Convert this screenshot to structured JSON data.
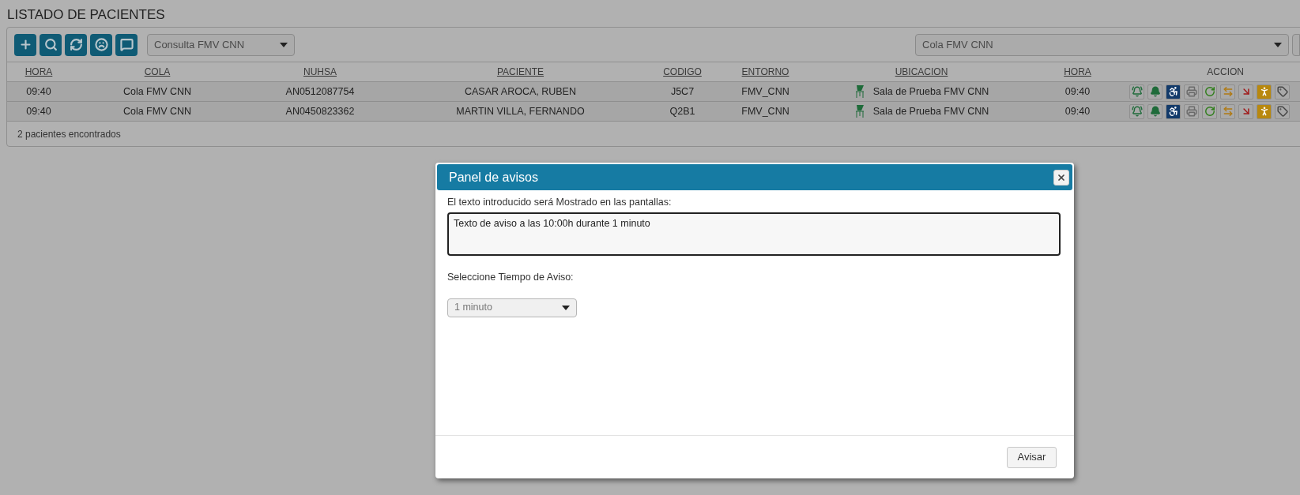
{
  "page_title": "LISTADO DE PACIENTES",
  "toolbar": {
    "consulta_select": "Consulta FMV CNN",
    "cola_select": "Cola FMV CNN"
  },
  "table": {
    "columns": [
      {
        "label": "HORA",
        "sortable": true
      },
      {
        "label": "COLA",
        "sortable": true
      },
      {
        "label": "NUHSA",
        "sortable": true
      },
      {
        "label": "PACIENTE",
        "sortable": true
      },
      {
        "label": "CODIGO",
        "sortable": true
      },
      {
        "label": "ENTORNO",
        "sortable": true
      },
      {
        "label": "UBICACION",
        "sortable": true
      },
      {
        "label": "HORA",
        "sortable": true
      },
      {
        "label": "ACCION",
        "sortable": false
      }
    ],
    "rows": [
      {
        "cells": [
          "09:40",
          "Cola FMV CNN",
          "AN0512087754",
          "CASAR AROCA, RUBEN",
          "J5C7",
          "FMV_CNN",
          "Sala de Prueba FMV CNN",
          "09:40"
        ]
      },
      {
        "cells": [
          "09:40",
          "Cola FMV CNN",
          "AN0450823362",
          "MARTIN VILLA, FERNANDO",
          "Q2B1",
          "FMV_CNN",
          "Sala de Prueba FMV CNN",
          "09:40"
        ]
      }
    ]
  },
  "status": "2 pacientes encontrados",
  "dialog": {
    "title": "Panel de avisos",
    "text_label": "El texto introducido será Mostrado en las pantallas:",
    "text_value": "Texto de aviso a las 10:00h durante 1 minuto",
    "time_label": "Seleccione Tiempo de Aviso:",
    "time_select": "1 minuto",
    "submit": "Avisar"
  }
}
